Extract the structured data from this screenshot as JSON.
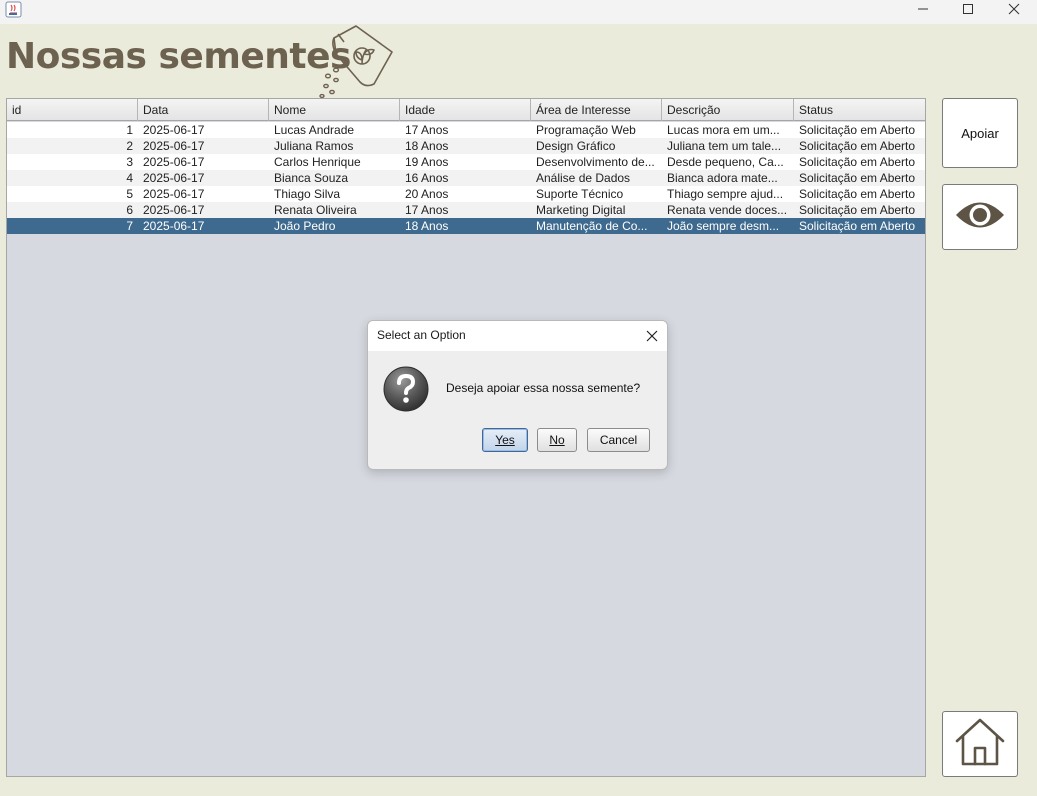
{
  "app": {
    "title": "Nossas sementes"
  },
  "table": {
    "columns": [
      "id",
      "Data",
      "Nome",
      "Idade",
      "Área de Interesse",
      "Descrição",
      "Status"
    ],
    "rows": [
      {
        "id": "1",
        "data": "2025-06-17",
        "nome": "Lucas Andrade",
        "idade": "17 Anos",
        "area": "Programação Web",
        "descricao": "Lucas mora em um...",
        "status": "Solicitação em Aberto"
      },
      {
        "id": "2",
        "data": "2025-06-17",
        "nome": "Juliana Ramos",
        "idade": "18 Anos",
        "area": "Design Gráfico",
        "descricao": "Juliana tem um tale...",
        "status": "Solicitação em Aberto"
      },
      {
        "id": "3",
        "data": "2025-06-17",
        "nome": "Carlos Henrique",
        "idade": "19 Anos",
        "area": "Desenvolvimento de...",
        "descricao": "Desde pequeno, Ca...",
        "status": "Solicitação em Aberto"
      },
      {
        "id": "4",
        "data": "2025-06-17",
        "nome": "Bianca Souza",
        "idade": "16 Anos",
        "area": "Análise de Dados",
        "descricao": "Bianca adora mate...",
        "status": "Solicitação em Aberto"
      },
      {
        "id": "5",
        "data": "2025-06-17",
        "nome": "Thiago Silva",
        "idade": "20 Anos",
        "area": "Suporte Técnico",
        "descricao": "Thiago sempre ajud...",
        "status": "Solicitação em Aberto"
      },
      {
        "id": "6",
        "data": "2025-06-17",
        "nome": "Renata Oliveira",
        "idade": "17 Anos",
        "area": "Marketing Digital",
        "descricao": "Renata vende doces...",
        "status": "Solicitação em Aberto"
      },
      {
        "id": "7",
        "data": "2025-06-17",
        "nome": "João Pedro",
        "idade": "18 Anos",
        "area": "Manutenção de Co...",
        "descricao": "João sempre desm...",
        "status": "Solicitação em Aberto"
      }
    ],
    "selected_row": 7
  },
  "side": {
    "apoiar_label": "Apoiar",
    "view_icon": "eye-icon",
    "home_icon": "home-icon"
  },
  "dialog": {
    "title": "Select an Option",
    "message": "Deseja apoiar essa nossa semente?",
    "icon": "question-icon",
    "yes_label": "Yes",
    "no_label": "No",
    "cancel_label": "Cancel"
  },
  "colors": {
    "background": "#ebebdc",
    "title_brown": "#6d6150",
    "selection": "#3d6a8e",
    "table_bg": "#d6d9e0"
  }
}
